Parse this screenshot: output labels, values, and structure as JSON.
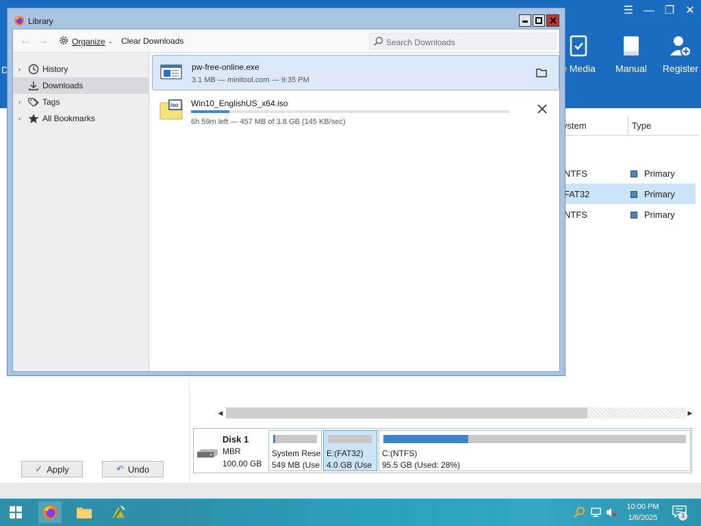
{
  "background_app": {
    "left_edge_label": "D",
    "toolbar": [
      {
        "label": "e Media",
        "icon": "bootable-media-icon"
      },
      {
        "label": "Manual",
        "icon": "manual-book-icon"
      },
      {
        "label": "Register",
        "icon": "register-user-icon"
      }
    ],
    "table_headers": {
      "filesystem": "ystem",
      "type": "Type"
    },
    "rows": [
      {
        "fs": "NTFS",
        "type": "Primary",
        "selected": false
      },
      {
        "fs": "FAT32",
        "type": "Primary",
        "selected": true
      },
      {
        "fs": "NTFS",
        "type": "Primary",
        "selected": false
      }
    ],
    "disk": {
      "name": "Disk 1",
      "type": "MBR",
      "size": "100.00 GB",
      "partitions": [
        {
          "line1": "System Rese",
          "line2": "549 MB (Use",
          "used_fraction": 0.05,
          "selected": false
        },
        {
          "line1": "E:(FAT32)",
          "line2": "4.0 GB (Use",
          "used_fraction": 0.0,
          "selected": true
        },
        {
          "line1": "C:(NTFS)",
          "line2": "95.5 GB (Used: 28%)",
          "used_fraction": 0.28,
          "selected": false
        }
      ]
    },
    "buttons": {
      "apply": "Apply",
      "undo": "Undo"
    }
  },
  "library": {
    "title": "Library",
    "toolbar": {
      "organize_label": "Organize",
      "clear_label": "Clear Downloads",
      "search_placeholder": "Search Downloads"
    },
    "sidebar": [
      {
        "label": "History",
        "icon": "clock-icon",
        "selected": false,
        "expandable": true
      },
      {
        "label": "Downloads",
        "icon": "download-icon",
        "selected": true,
        "expandable": false
      },
      {
        "label": "Tags",
        "icon": "tag-icon",
        "selected": false,
        "expandable": true
      },
      {
        "label": "All Bookmarks",
        "icon": "star-icon",
        "selected": false,
        "expandable": true
      }
    ],
    "downloads": [
      {
        "name": "pw-free-online.exe",
        "meta": "3.1 MB — minitool.com — 9:35 PM",
        "status": "complete"
      },
      {
        "name": "Win10_EnglishUS_x64.iso",
        "meta": "6h 59m left — 457 MB of 3.8 GB (145 KB/sec)",
        "progress": 0.12,
        "status": "in-progress"
      }
    ]
  },
  "taskbar": {
    "clock_time": "10:00 PM",
    "clock_date": "1/6/2025",
    "notification_count": "3"
  },
  "colors": {
    "header_blue": "#1a6cc1",
    "selection": "#cce4f7",
    "progress": "#3a86d8",
    "taskbar": "#2e8fa8"
  }
}
